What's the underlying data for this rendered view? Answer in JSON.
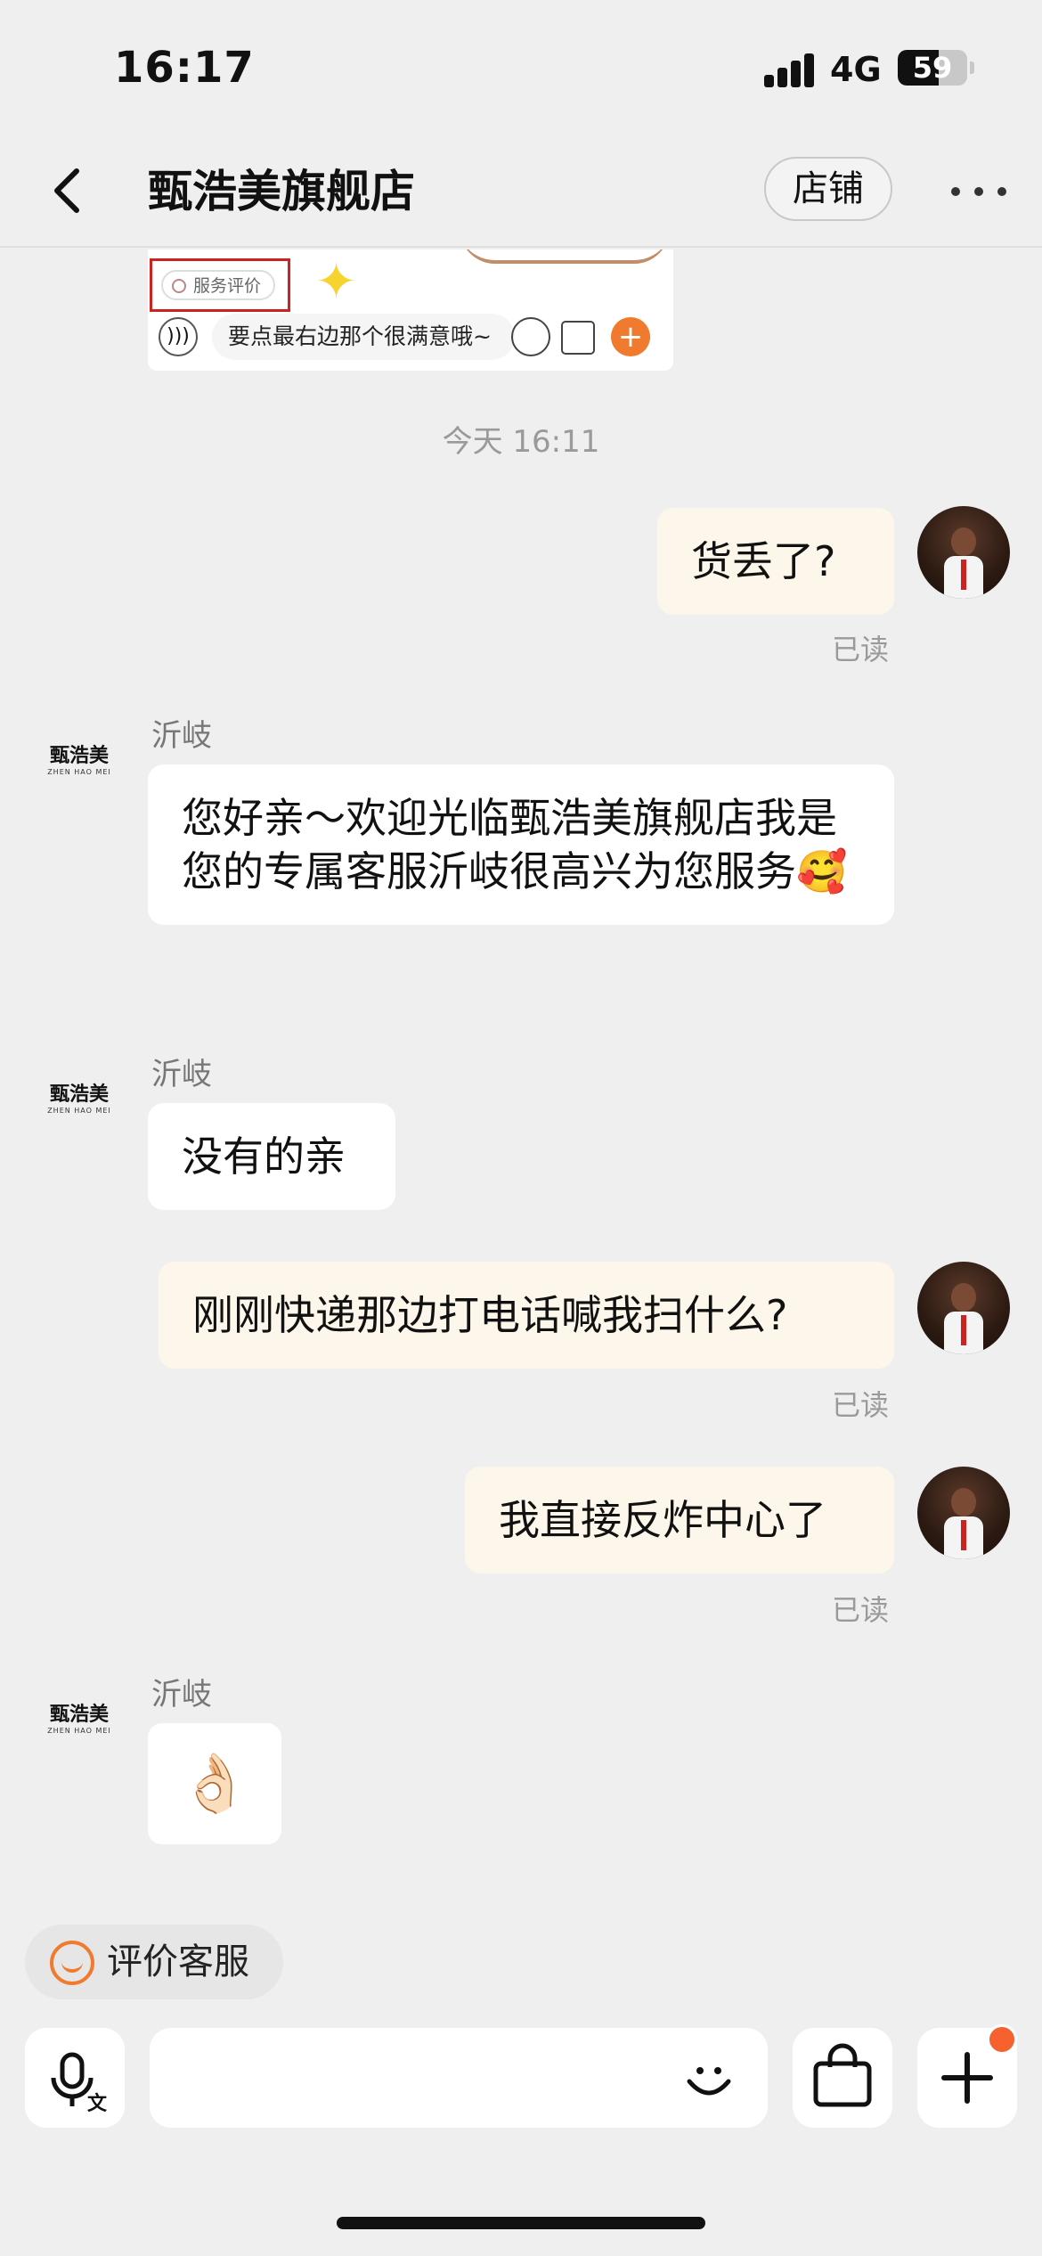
{
  "status_bar": {
    "time": "16:17",
    "network": "4G",
    "battery": "59",
    "battery_level": 0.59
  },
  "header": {
    "title": "甄浩美旗舰店",
    "shop_button": "店铺",
    "back_icon": "chevron-left-icon",
    "more_icon": "more-dots-icon"
  },
  "top_card": {
    "service_tag": "服务评价",
    "input_text": "要点最右边那个很满意哦~"
  },
  "timestamp": "今天 16:11",
  "messages": [
    {
      "side": "out",
      "text": "货丢了?",
      "read": "已读"
    },
    {
      "side": "in",
      "sender": "沂岐",
      "text": "您好亲～欢迎光临甄浩美旗舰店我是您的专属客服沂岐很高兴为您服务",
      "emoji": "🥰"
    },
    {
      "side": "in",
      "sender": "沂岐",
      "text": "没有的亲"
    },
    {
      "side": "out",
      "text": "刚刚快递那边打电话喊我扫什么?",
      "read": "已读"
    },
    {
      "side": "out",
      "text": "我直接反炸中心了",
      "read": "已读"
    },
    {
      "side": "in",
      "sender": "沂岐",
      "emoji": "👌🏻"
    }
  ],
  "store_avatar": {
    "brand": "甄浩美",
    "brand_sub": "ZHEN HAO MEI"
  },
  "rate_chip": {
    "label": "评价客服",
    "icon": "smile-icon"
  },
  "input_bar": {
    "voice_icon": "voice-translate-icon",
    "emoji_icon": "smile-icon",
    "bag_icon": "shopping-bag-icon",
    "plus_icon": "plus-icon",
    "has_badge": true
  },
  "colors": {
    "accent": "#f07a2e",
    "out_bubble": "#fdf6ea",
    "in_bubble": "#ffffff",
    "background": "#efefef",
    "badge": "#f5622d"
  }
}
